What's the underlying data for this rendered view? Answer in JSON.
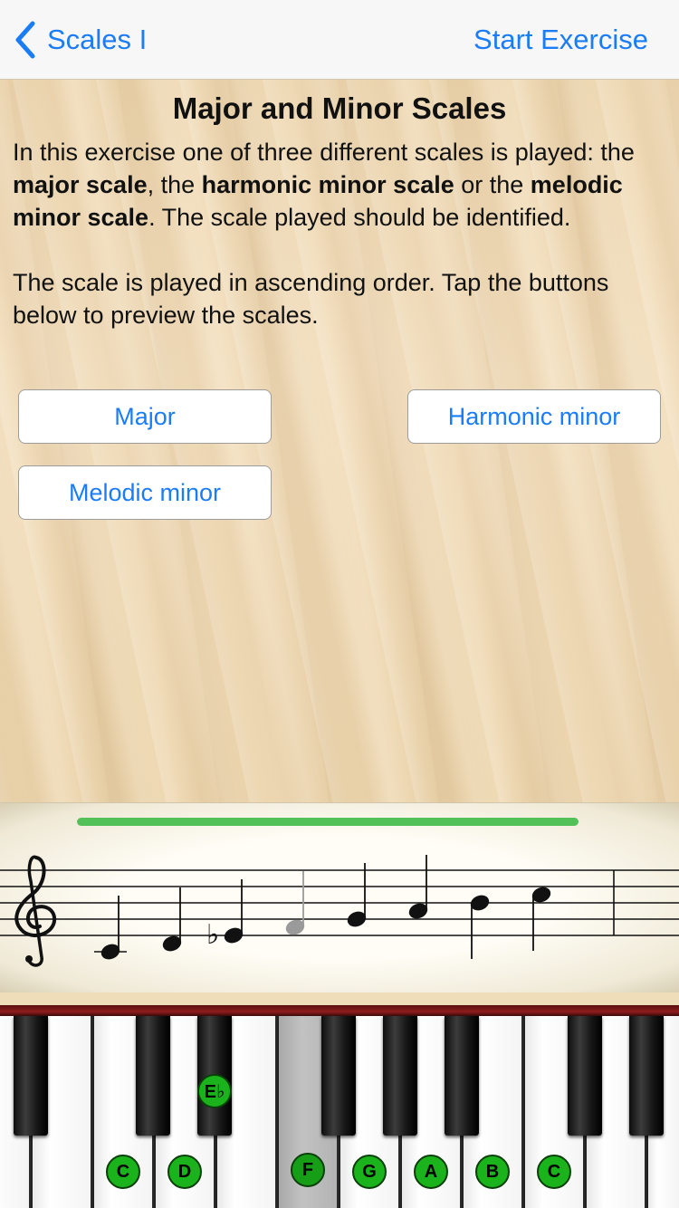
{
  "navbar": {
    "back_label": "Scales I",
    "action_label": "Start Exercise"
  },
  "content": {
    "title": "Major and Minor Scales",
    "para1": {
      "t1": "In this exercise one of three different scales is played: the ",
      "b1": "major scale",
      "t2": ", the ",
      "b2": "harmonic minor scale",
      "t3": " or the ",
      "b3": "melodic minor scale",
      "t4": ". The scale played should be identified."
    },
    "para2": "The scale is played in ascending order. Tap the buttons below to preview the scales."
  },
  "buttons": {
    "major": "Major",
    "harmonic": "Harmonic minor",
    "melodic": "Melodic minor"
  },
  "staff": {
    "progress_percent": 100,
    "progress_color": "#52c157",
    "clef": "treble-clef",
    "notes": [
      {
        "name": "C",
        "accidental": "",
        "played": true
      },
      {
        "name": "D",
        "accidental": "",
        "played": true
      },
      {
        "name": "Eb",
        "accidental": "♭",
        "played": true
      },
      {
        "name": "F",
        "accidental": "",
        "played": false
      },
      {
        "name": "G",
        "accidental": "",
        "played": true
      },
      {
        "name": "A",
        "accidental": "",
        "played": true
      },
      {
        "name": "B",
        "accidental": "",
        "played": true
      },
      {
        "name": "C",
        "accidental": "",
        "played": true
      }
    ]
  },
  "piano": {
    "badges": {
      "c1": "C",
      "d": "D",
      "eb": "E♭",
      "f": "F",
      "g": "G",
      "a": "A",
      "b": "B",
      "c2": "C"
    },
    "badge_color": "#1bb31b"
  }
}
